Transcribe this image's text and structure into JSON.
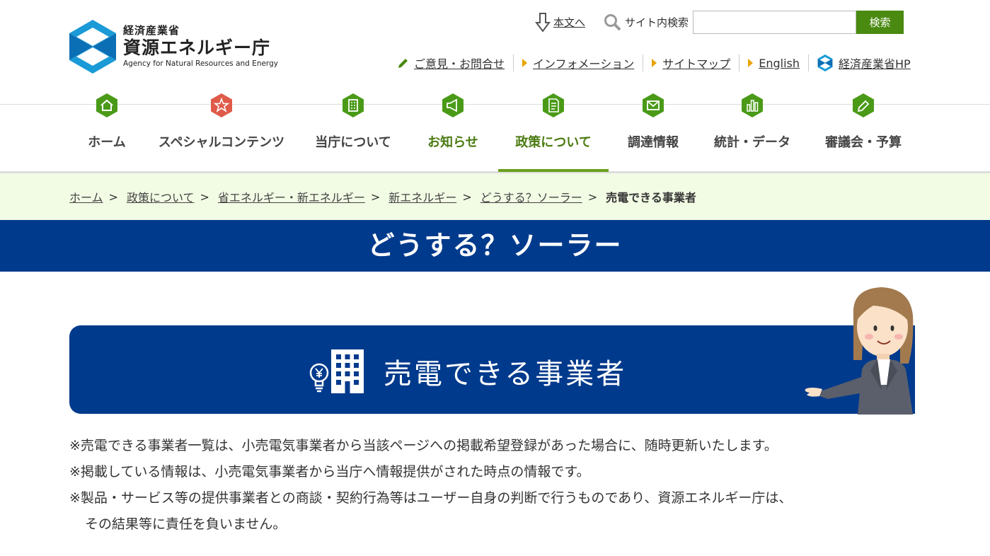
{
  "logo": {
    "ministry": "経済産業省",
    "agency": "資源エネルギー庁",
    "english": "Agency for Natural Resources and Energy"
  },
  "header": {
    "skip_link": "本文へ",
    "search_label": "サイト内検索",
    "search_value": "",
    "search_button": "検索",
    "links": [
      {
        "label": "ご意見・お問合せ",
        "icon": "pencil-icon"
      },
      {
        "label": "インフォメーション",
        "icon": "arrow-icon"
      },
      {
        "label": "サイトマップ",
        "icon": "arrow-icon"
      },
      {
        "label": "English",
        "icon": "arrow-icon"
      },
      {
        "label": "経済産業省HP",
        "icon": "meti-logo-icon"
      }
    ]
  },
  "nav": [
    {
      "label": "ホーム",
      "icon": "home-icon"
    },
    {
      "label": "スペシャルコンテンツ",
      "icon": "star-icon"
    },
    {
      "label": "当庁について",
      "icon": "building-icon"
    },
    {
      "label": "お知らせ",
      "icon": "megaphone-icon"
    },
    {
      "label": "政策について",
      "icon": "document-icon"
    },
    {
      "label": "調達情報",
      "icon": "mail-icon"
    },
    {
      "label": "統計・データ",
      "icon": "bar-chart-icon"
    },
    {
      "label": "審議会・予算",
      "icon": "pencil-icon"
    }
  ],
  "breadcrumb": {
    "items": [
      "ホーム",
      "政策について",
      "省エネルギー・新エネルギー",
      "新エネルギー",
      "どうする？ソーラー"
    ],
    "separator": ">",
    "current": "売電できる事業者"
  },
  "page_title": "どうする？ソーラー",
  "section": {
    "title": "売電できる事業者"
  },
  "notes": [
    "※売電できる事業者一覧は、小売電気事業者から当該ページへの掲載希望登録があった場合に、随時更新いたします。",
    "※掲載している情報は、小売電気事業者から当庁へ情報提供がされた時点の情報です。",
    "※製品・サービス等の提供事業者との商談・契約行為等はユーザー自身の判断で行うものであり、資源エネルギー庁は、",
    "その結果等に責任を負いません。"
  ],
  "colors": {
    "brand_blue": "#003a8c",
    "nav_green": "#4a8a10",
    "special_red": "#e05a4a",
    "breadcrumb_bg": "#f2fbe4",
    "accent_orange": "#e8a400"
  }
}
